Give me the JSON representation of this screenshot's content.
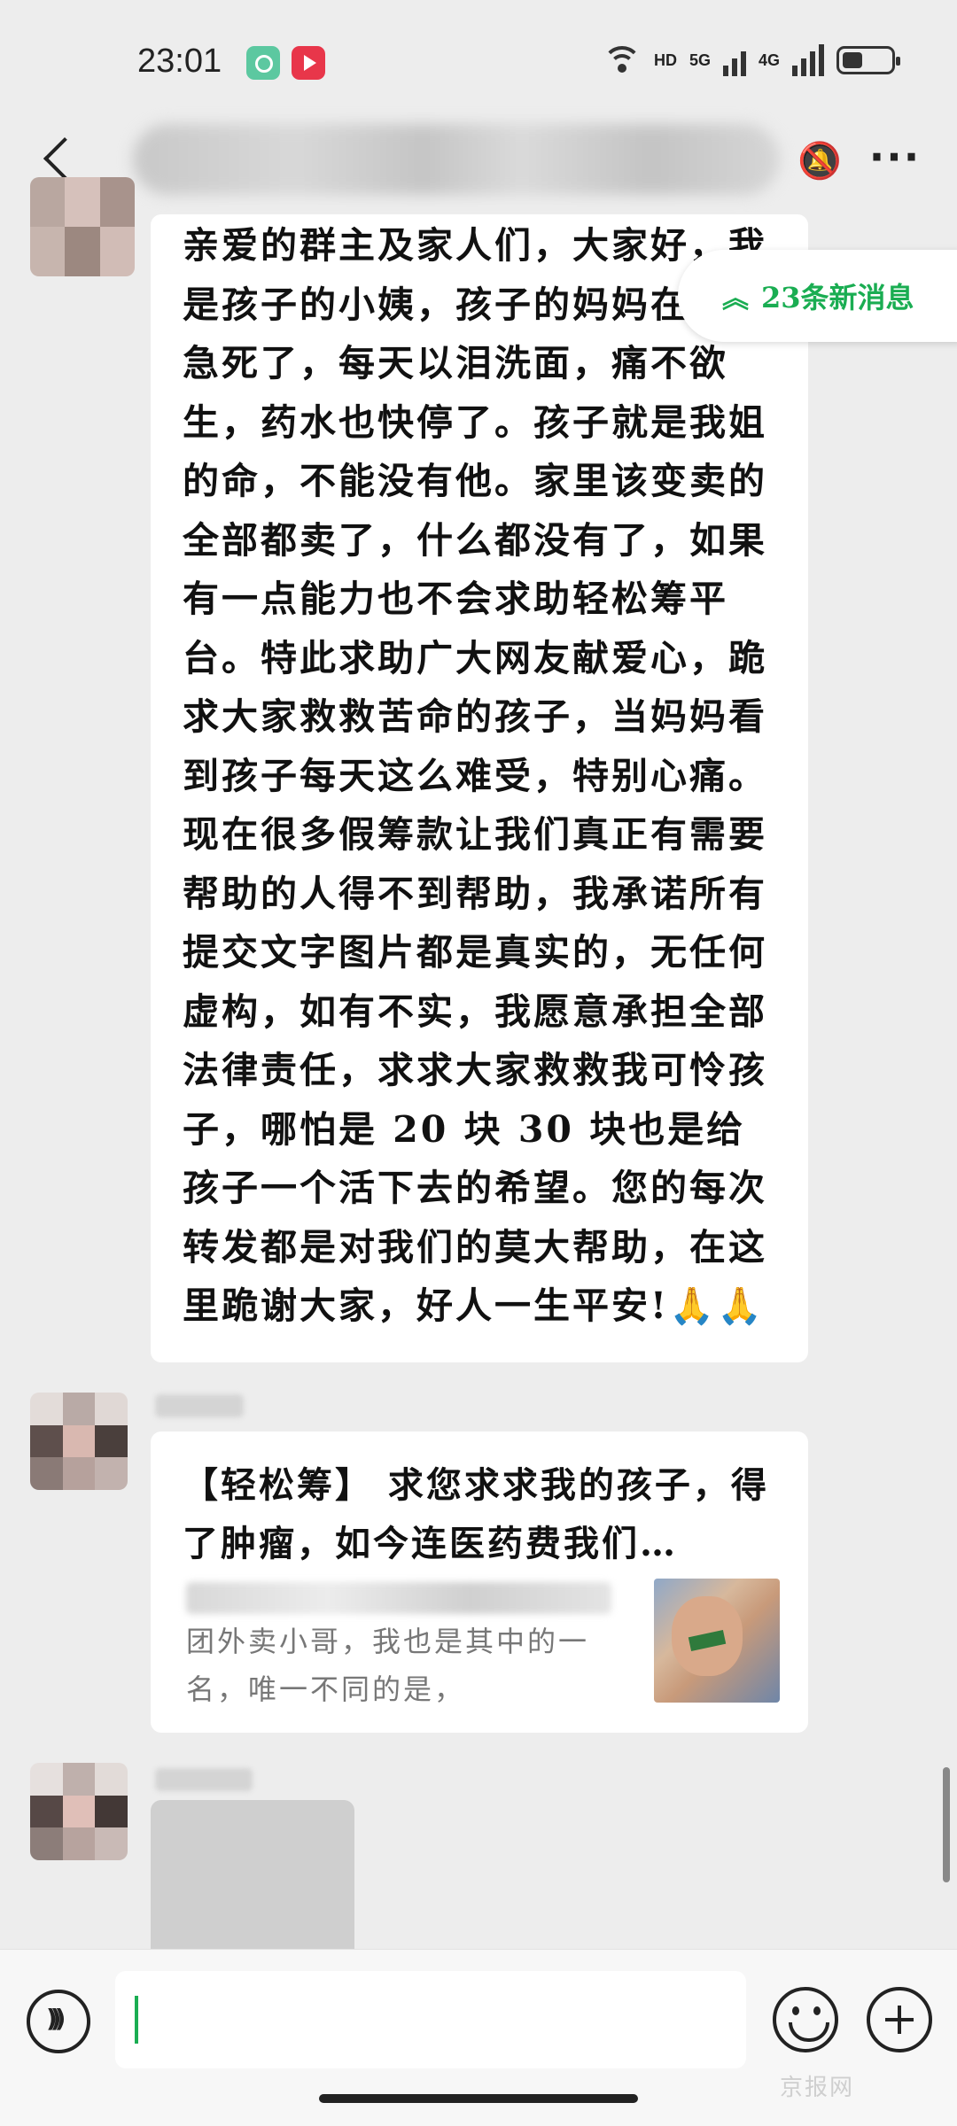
{
  "status_bar": {
    "time": "23:01",
    "network_labels": [
      "HD",
      "5G",
      "4G"
    ],
    "icons": [
      "video-app-icon",
      "play-app-icon",
      "wifi-icon",
      "signal-icon",
      "battery-icon"
    ]
  },
  "header": {
    "icons": [
      "back-icon",
      "mute-icon",
      "more-icon"
    ],
    "more_label": "···"
  },
  "new_messages": {
    "chevron": "︽",
    "label": "23条新消息",
    "color": "#1aad52"
  },
  "messages": [
    {
      "type": "text",
      "text": "亲爱的群主及家人们，大家好，我是孩子的小姨，孩子的妈妈在医院急死了，每天以泪洗面，痛不欲生，药水也快停了。孩子就是我姐的命，不能没有他。家里该变卖的全部都卖了，什么都没有了，如果有一点能力也不会求助轻松筹平台。特此求助广大网友献爱心，跪求大家救救苦命的孩子，当妈妈看到孩子每天这么难受，特别心痛。现在很多假筹款让我们真正有需要帮助的人得不到帮助，我承诺所有提交文字图片都是真实的，无任何虚构，如有不实，我愿意承担全部法律责任，求求大家救救我可怜孩子，哪怕是 20 块 30 块也是给孩子一个活下去的希望。您的每次转发都是对我们的莫大帮助，在这里跪谢大家，好人一生平安!🙏🙏"
    },
    {
      "type": "link",
      "title": "【轻松筹】 求您求求我的孩子，得了肿瘤，如今连医药费我们…",
      "description": "团外卖小哥，我也是其中的一名，唯一不同的是，"
    },
    {
      "type": "image"
    }
  ],
  "input_bar": {
    "placeholder": "",
    "icons": [
      "voice-icon",
      "emoji-icon",
      "plus-icon"
    ],
    "watermark": "京报网"
  },
  "colors": {
    "background": "#ededed",
    "bubble": "#ffffff",
    "accent": "#1aad52"
  }
}
